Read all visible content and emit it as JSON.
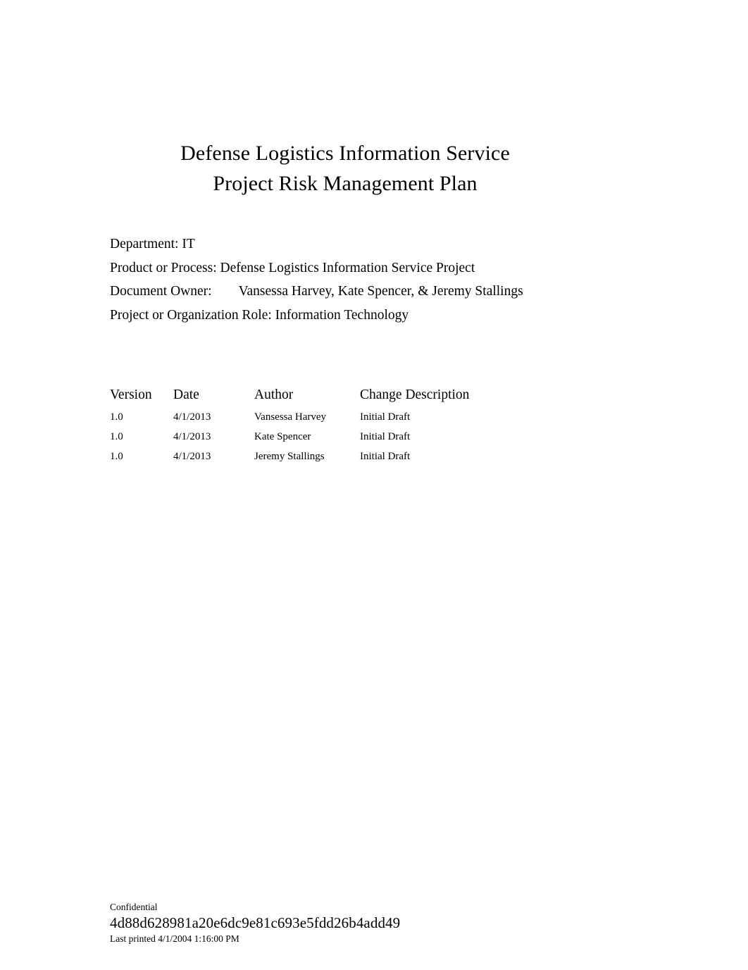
{
  "document": {
    "title_lines": [
      "Defense Logistics Information Service",
      "Project Risk Management Plan"
    ],
    "metadata": [
      {
        "label": "Department:",
        "value": "IT",
        "tab": false
      },
      {
        "label": "Product or Process:",
        "value": "Defense Logistics Information Service Project",
        "tab": false
      },
      {
        "label": "Document Owner:",
        "value": "Vansessa Harvey, Kate Spencer, & Jeremy Stallings",
        "tab": true
      },
      {
        "label": "Project or Organization Role:",
        "value": "Information Technology",
        "tab": false
      }
    ],
    "revision_history": {
      "columns": [
        "Version",
        "Date",
        "Author",
        "Change Description"
      ],
      "rows": [
        {
          "version": "1.0",
          "date": "4/1/2013",
          "author": "Vansessa Harvey",
          "change": "Initial Draft"
        },
        {
          "version": "1.0",
          "date": "4/1/2013",
          "author": "Kate Spencer",
          "change": "Initial Draft"
        },
        {
          "version": "1.0",
          "date": "4/1/2013",
          "author": "Jeremy Stallings",
          "change": "Initial Draft"
        }
      ]
    },
    "footer": {
      "classification": "Confidential",
      "document_hash": "4d88d628981a20e6dc9e81c693e5fdd26b4add49",
      "last_printed": "Last printed 4/1/2004 1:16:00 PM"
    },
    "colors": {
      "page_background": "#ffffff",
      "text": "#000000"
    }
  }
}
